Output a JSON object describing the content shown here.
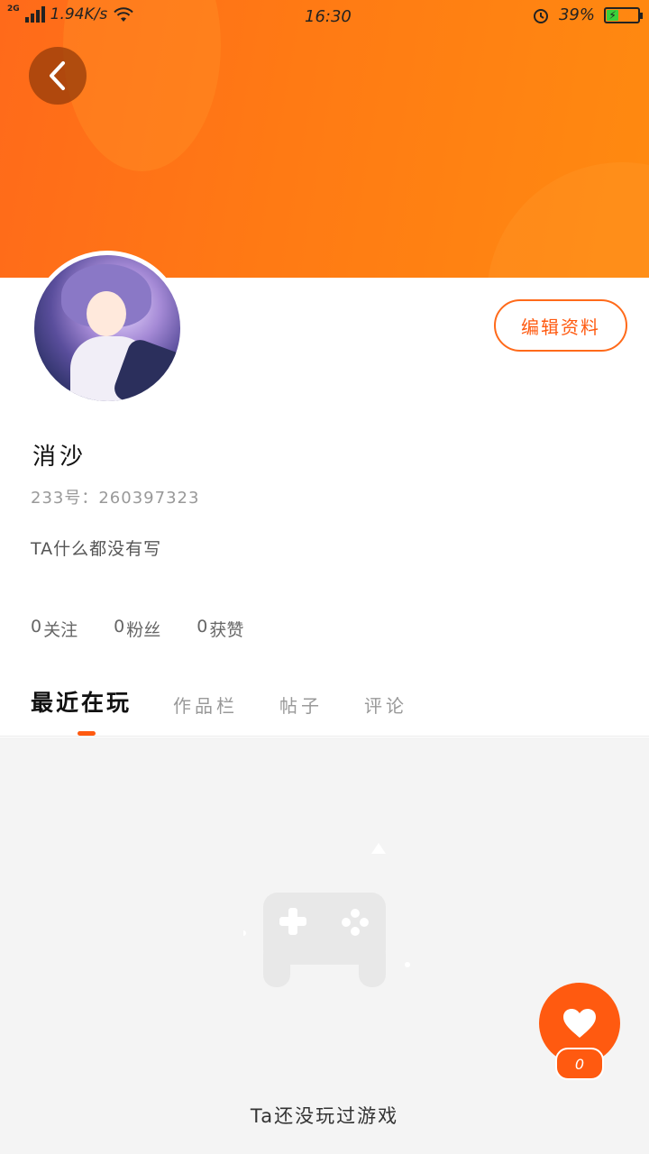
{
  "status_bar": {
    "network": "2G",
    "speed": "1.94K/s",
    "time": "16:30",
    "battery_pct": "39%",
    "battery_level": 0.39
  },
  "header": {
    "back_icon": "chevron-left-icon"
  },
  "profile": {
    "edit_label": "编辑资料",
    "username": "消沙",
    "uid": "233号：260397323",
    "bio": "TA什么都没有写",
    "stats": [
      {
        "count": "0",
        "label": "关注"
      },
      {
        "count": "0",
        "label": "粉丝"
      },
      {
        "count": "0",
        "label": "获赞"
      }
    ]
  },
  "tabs": [
    {
      "label": "最近在玩",
      "active": true
    },
    {
      "label": "作品栏",
      "active": false
    },
    {
      "label": "帖子",
      "active": false
    },
    {
      "label": "评论",
      "active": false
    }
  ],
  "empty_state": {
    "icon": "gamepad-icon",
    "text": "Ta还没玩过游戏"
  },
  "fab": {
    "icon": "heart-icon",
    "count": "0"
  },
  "colors": {
    "accent": "#ff5a10",
    "banner_start": "#ff6a1a",
    "banner_end": "#ff8a10"
  }
}
